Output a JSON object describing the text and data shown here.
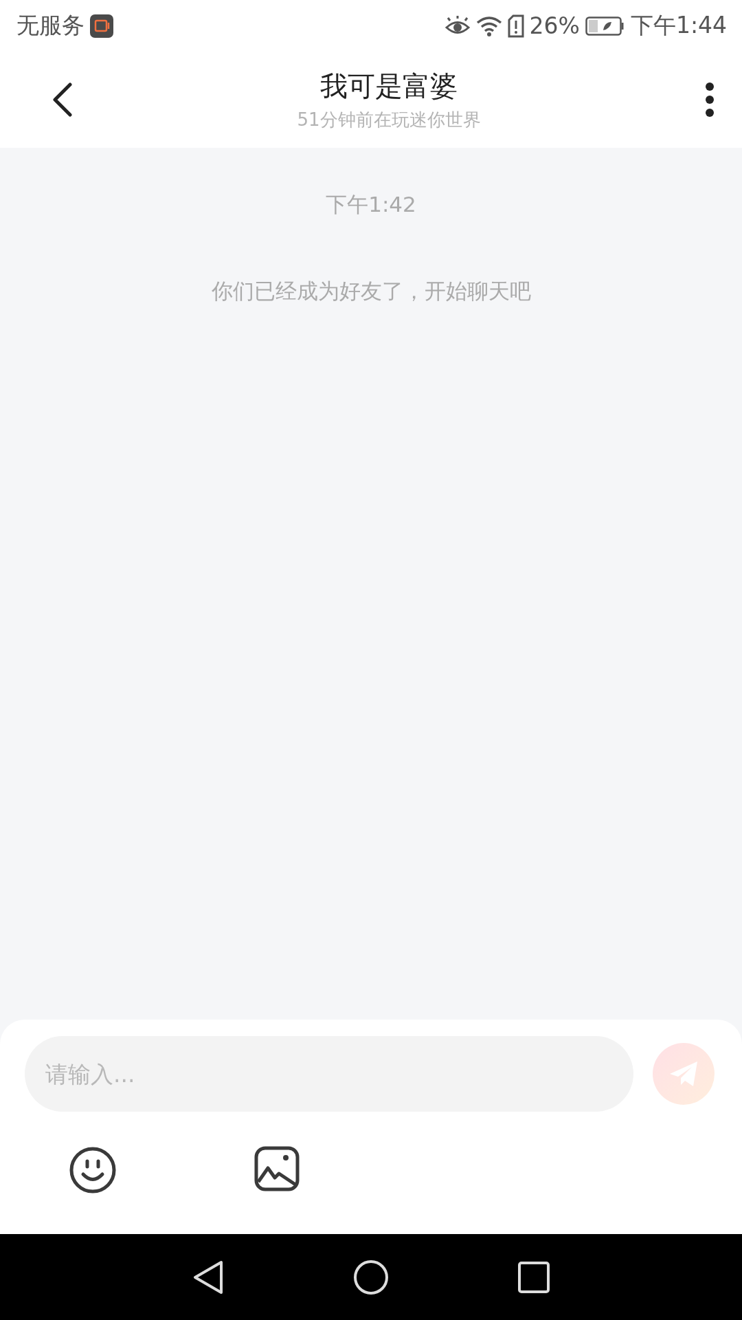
{
  "status_bar": {
    "carrier": "无服务",
    "battery_percent": "26%",
    "time": "下午1:44"
  },
  "header": {
    "title": "我可是富婆",
    "subtitle": "51分钟前在玩迷你世界"
  },
  "chat": {
    "timestamp": "下午1:42",
    "system_message": "你们已经成为好友了，开始聊天吧"
  },
  "composer": {
    "placeholder": "请输入..."
  }
}
